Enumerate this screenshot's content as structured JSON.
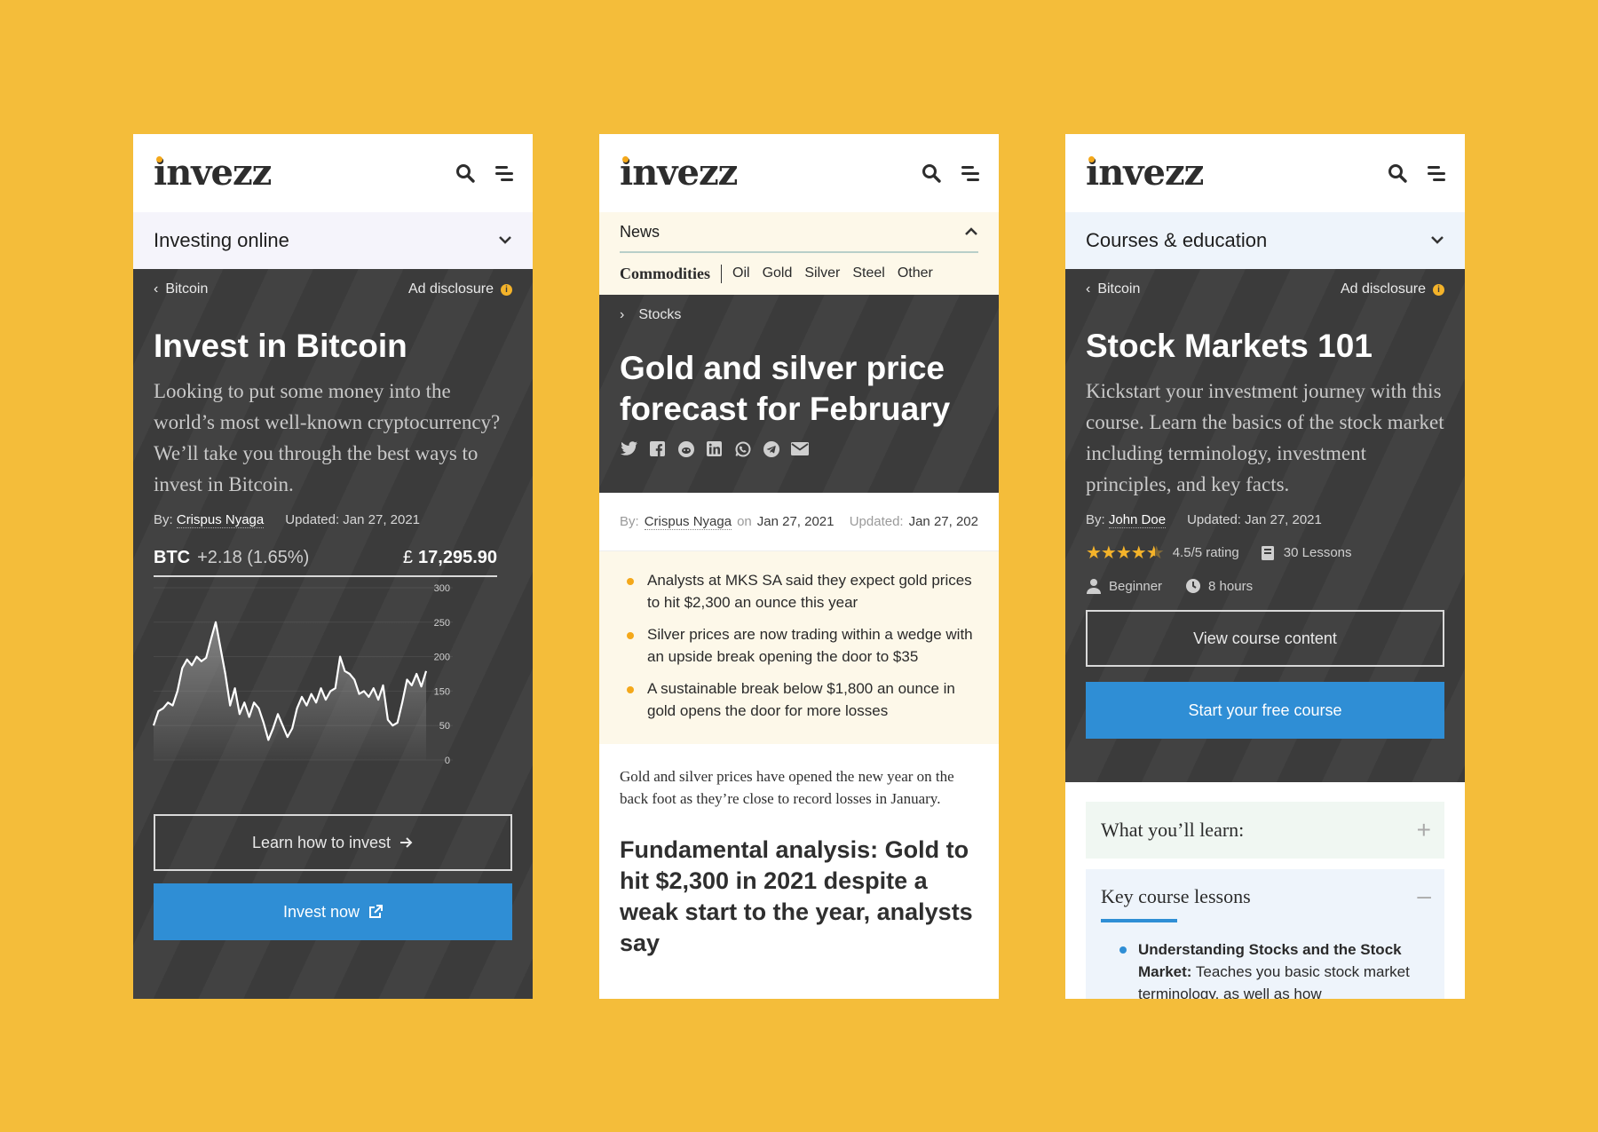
{
  "brand": "invezz",
  "p1": {
    "section": "Investing online",
    "crumb": "Bitcoin",
    "ad": "Ad disclosure",
    "title": "Invest in Bitcoin",
    "lead": "Looking to put some money into the world’s most well-known cryptocurrency? We’ll take you through the best ways to invest in Bitcoin.",
    "by_label": "By:",
    "author": "Crispus Nyaga",
    "updated": "Updated: Jan 27, 2021",
    "ticker": {
      "symbol": "BTC",
      "change": "+2.18 (1.65%)",
      "currency": "£",
      "price": "17,295.90"
    },
    "btn_learn": "Learn how to invest",
    "btn_invest": "Invest now"
  },
  "chart_data": {
    "type": "area",
    "yticks": [
      "300",
      "250",
      "200",
      "150",
      "50",
      "0"
    ],
    "ylim": [
      0,
      300
    ],
    "values": [
      60,
      85,
      90,
      100,
      95,
      120,
      160,
      175,
      165,
      180,
      172,
      178,
      210,
      240,
      195,
      150,
      95,
      125,
      80,
      100,
      75,
      100,
      90,
      65,
      35,
      55,
      80,
      60,
      40,
      55,
      90,
      110,
      95,
      115,
      100,
      125,
      105,
      120,
      125,
      180,
      155,
      150,
      140,
      115,
      120,
      110,
      125,
      105,
      130,
      70,
      60,
      65,
      100,
      140,
      130,
      150,
      128,
      155
    ]
  },
  "p2": {
    "section": "News",
    "category": "Commodities",
    "tags": [
      "Oil",
      "Gold",
      "Silver",
      "Steel",
      "Other"
    ],
    "crumb": "Stocks",
    "title": "Gold and silver price forecast for February",
    "share": [
      "twitter-icon",
      "facebook-icon",
      "reddit-icon",
      "linkedin-icon",
      "whatsapp-icon",
      "telegram-icon",
      "email-icon"
    ],
    "by_label": "By:",
    "author": "Crispus Nyaga",
    "on_label": "on",
    "date": "Jan 27, 2021",
    "updated_label": "Updated:",
    "updated": "Jan 27, 202",
    "bullets": [
      "Analysts at MKS SA said they expect gold prices to hit $2,300 an ounce this year",
      "Silver prices are now trading within a wedge with an upside break opening the door to $35",
      "A sustainable break below $1,800 an ounce in gold opens the door for more losses"
    ],
    "body": "Gold and silver prices have opened the new year on the back foot as they’re close to record losses in January.",
    "h2": "Fundamental analysis: Gold to hit $2,300 in 2021 despite a weak start to the year, analysts say"
  },
  "p3": {
    "section": "Courses & education",
    "crumb": "Bitcoin",
    "ad": "Ad disclosure",
    "title": "Stock Markets 101",
    "lead": "Kickstart your investment journey with this course. Learn the basics of the stock market including terminology, investment principles, and key facts.",
    "by_label": "By:",
    "author": "John Doe",
    "updated": "Updated: Jan 27, 2021",
    "rating": "4.5/5 rating",
    "rating_value": 4.5,
    "lessons": "30 Lessons",
    "level": "Beginner",
    "duration": "8 hours",
    "btn_view": "View course content",
    "btn_start": "Start your free course",
    "learn_title": "What you’ll learn:",
    "lessons_title": "Key course lessons",
    "lesson_1_bold": "Understanding Stocks and the Stock Market:",
    "lesson_1_rest": " Teaches you basic stock market terminology, as well as how"
  },
  "colors": {
    "background": "#f4bd3a",
    "dark_panel": "#3b3b3b",
    "accent_blue": "#2f8ed5",
    "accent_yellow": "#f4a81a"
  }
}
